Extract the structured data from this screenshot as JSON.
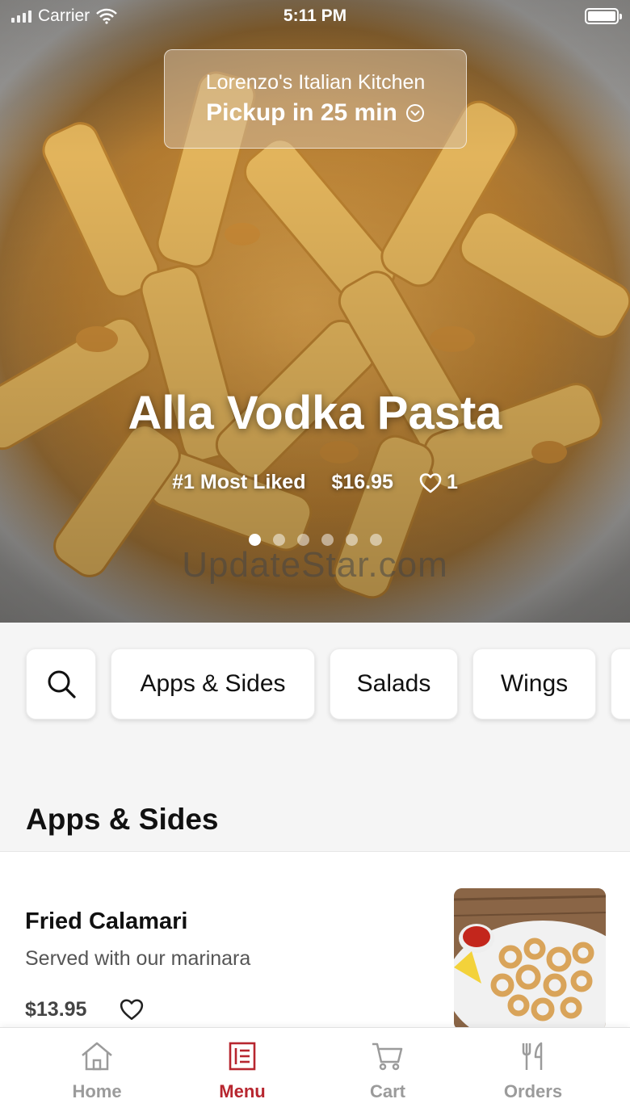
{
  "status_bar": {
    "carrier": "Carrier",
    "time": "5:11 PM"
  },
  "restaurant": {
    "name": "Lorenzo's Italian Kitchen",
    "pickup": "Pickup in 25 min"
  },
  "featured": {
    "title": "Alla Vodka Pasta",
    "rank": "#1 Most Liked",
    "price": "$16.95",
    "likes": "1",
    "slide_count": 6,
    "active_slide": 1,
    "watermark": "UpdateStar.com"
  },
  "categories": {
    "search_icon": "search-icon",
    "items": [
      "Apps & Sides",
      "Salads",
      "Wings"
    ]
  },
  "section": {
    "title": "Apps & Sides"
  },
  "menu_items": [
    {
      "name": "Fried Calamari",
      "description": "Served with our marinara",
      "price": "$13.95"
    }
  ],
  "tab_bar": {
    "tabs": [
      {
        "label": "Home",
        "icon": "home-icon"
      },
      {
        "label": "Menu",
        "icon": "menu-icon"
      },
      {
        "label": "Cart",
        "icon": "cart-icon"
      },
      {
        "label": "Orders",
        "icon": "fork-knife-icon"
      }
    ],
    "active_tab": "Menu"
  },
  "colors": {
    "accent": "#b7262f",
    "inactive": "#9b9b9b"
  }
}
